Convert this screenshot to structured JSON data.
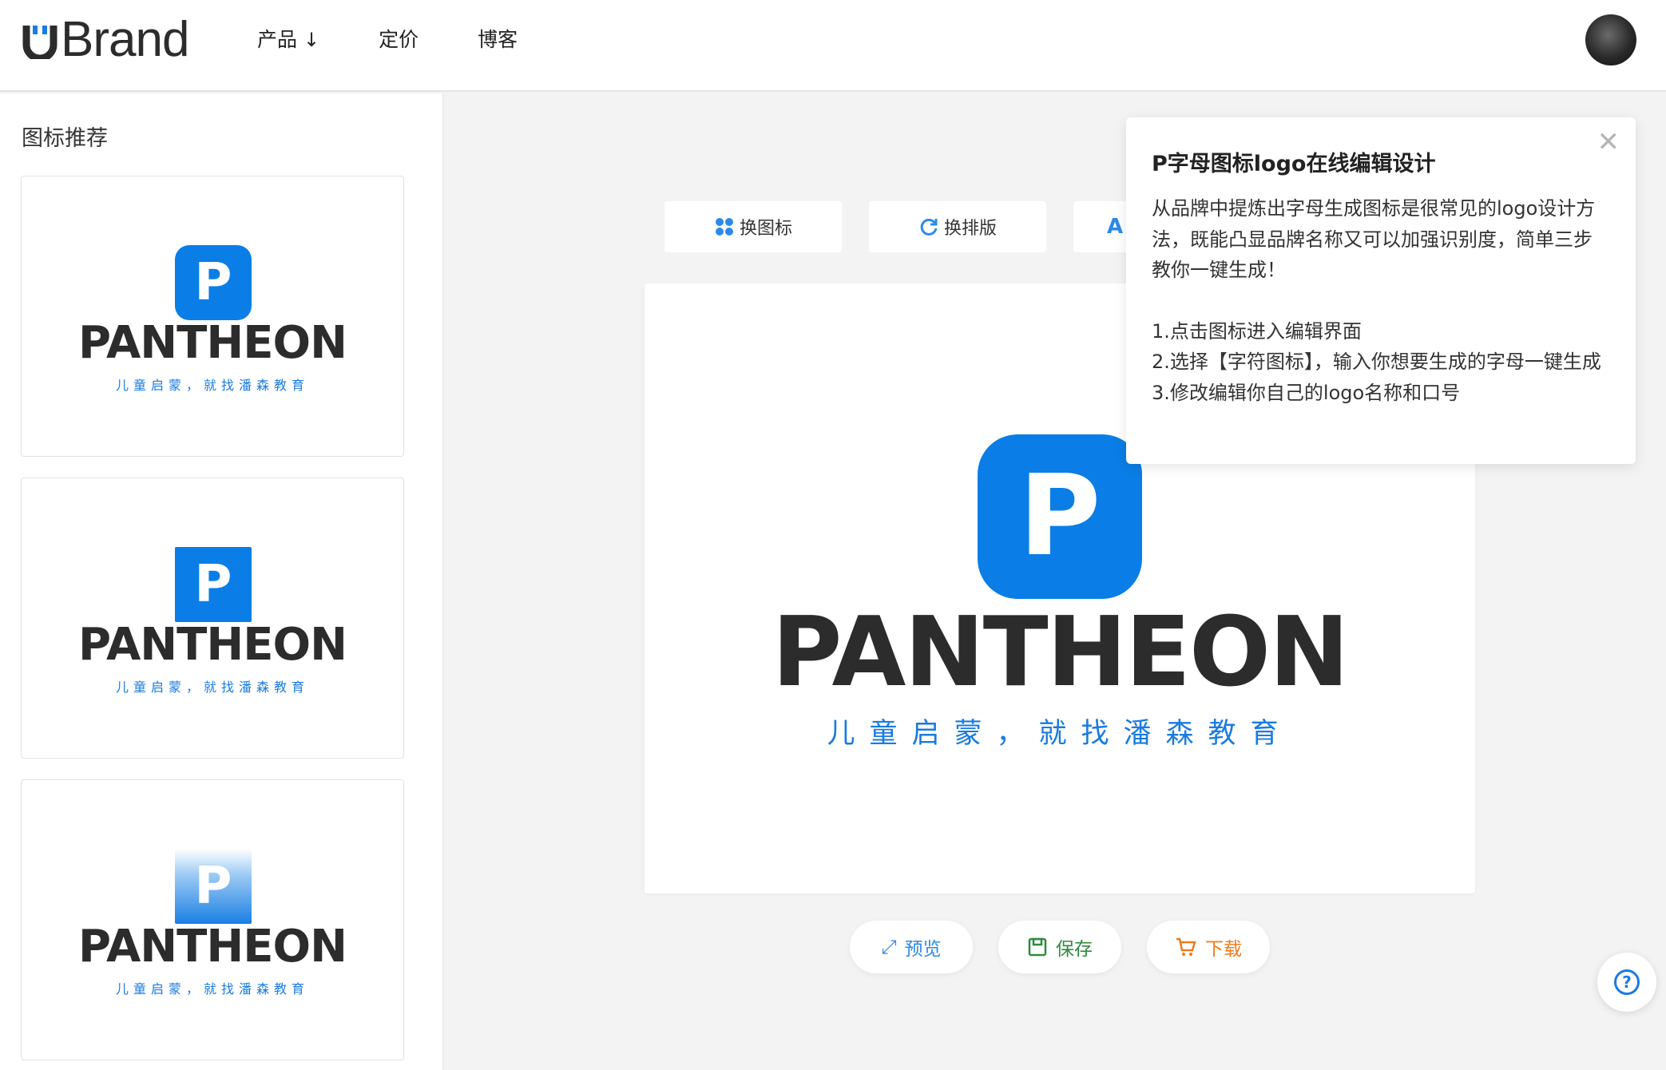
{
  "header": {
    "logo_text": "Brand",
    "nav": [
      {
        "label": "产品",
        "arrow": "↓"
      },
      {
        "label": "定价"
      },
      {
        "label": "博客"
      }
    ]
  },
  "sidebar": {
    "title": "图标推荐",
    "cards": [
      {
        "mark_letter": "P",
        "brand": "PANTHEON",
        "slogan": "儿童启蒙，就找潘森教育",
        "mark_style": "rounded"
      },
      {
        "mark_letter": "P",
        "brand": "PANTHEON",
        "slogan": "儿童启蒙，就找潘森教育",
        "mark_style": "square"
      },
      {
        "mark_letter": "P",
        "brand": "PANTHEON",
        "slogan": "儿童启蒙，就找潘森教育",
        "mark_style": "gradient"
      }
    ]
  },
  "toolbar": {
    "change_icon": "换图标",
    "change_layout": "换排版",
    "third_partial": "A"
  },
  "canvas": {
    "mark_letter": "P",
    "brand": "PANTHEON",
    "slogan": "儿童启蒙，就找潘森教育"
  },
  "actions": {
    "preview": "预览",
    "save": "保存",
    "download": "下载"
  },
  "popover": {
    "title": "P字母图标logo在线编辑设计",
    "intro": "从品牌中提炼出字母生成图标是很常见的logo设计方法，既能凸显品牌名称又可以加强识别度，简单三步教你一键生成！",
    "step1": "1.点击图标进入编辑界面",
    "step2": "2.选择【字符图标】，输入你想要生成的字母一键生成",
    "step3": "3.修改编辑你自己的logo名称和口号"
  },
  "colors": {
    "brand_blue": "#0a7ee6",
    "preview_blue": "#2b8ae8",
    "save_green": "#2e8b3e",
    "download_orange": "#f07c1a"
  }
}
